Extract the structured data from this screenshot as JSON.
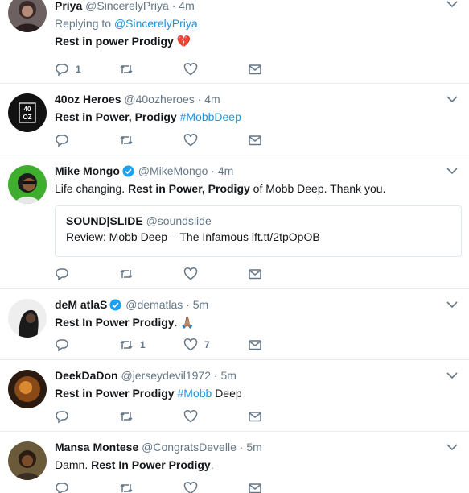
{
  "tweets": [
    {
      "name": "Priya",
      "handle": "@SincerelyPriya",
      "time": "4m",
      "verified": false,
      "reply_prefix": "Replying to",
      "reply_handle": "@SincerelyPriya",
      "text_bold": "Rest in power Prodigy",
      "emoji": "💔",
      "counts": {
        "reply": "1",
        "retweet": "",
        "like": ""
      }
    },
    {
      "name": "40oz Heroes",
      "handle": "@40ozheroes",
      "time": "4m",
      "verified": false,
      "text_bold": "Rest in Power, Prodigy",
      "hashtag": "#MobbDeep",
      "counts": {
        "reply": "",
        "retweet": "",
        "like": ""
      }
    },
    {
      "name": "Mike Mongo",
      "handle": "@MikeMongo",
      "time": "4m",
      "verified": true,
      "text_pre": "Life changing.",
      "text_bold": "Rest in Power, Prodigy",
      "text_post": "of Mobb Deep. Thank you.",
      "quote": {
        "name": "SOUND|SLIDE",
        "handle": "@soundslide",
        "text": "Review: Mobb Deep – The Infamous ift.tt/2tpOpOB"
      },
      "counts": {
        "reply": "",
        "retweet": "",
        "like": ""
      }
    },
    {
      "name": "deM atlaS",
      "handle": "@dematlas",
      "time": "5m",
      "verified": true,
      "text_bold": "Rest In Power Prodigy",
      "text_post": ".",
      "emoji": "🙏🏽",
      "counts": {
        "reply": "",
        "retweet": "1",
        "like": "7"
      }
    },
    {
      "name": "DeekDaDon",
      "handle": "@jerseydevil1972",
      "time": "5m",
      "verified": false,
      "text_bold": "Rest in Power Prodigy",
      "hashtag": "#Mobb",
      "text_post": "Deep",
      "counts": {
        "reply": "",
        "retweet": "",
        "like": ""
      }
    },
    {
      "name": "Mansa Montese",
      "handle": "@CongratsDevelle",
      "time": "5m",
      "verified": false,
      "text_pre": "Damn.",
      "text_bold": "Rest In Power Prodigy",
      "text_post": ".",
      "counts": {
        "reply": "",
        "retweet": "",
        "like": ""
      }
    }
  ],
  "colors": {
    "accent": "#1b95e0",
    "muted": "#657786",
    "text": "#14171a",
    "border": "#e6ecf0"
  },
  "icons": {
    "reply": "reply-icon",
    "retweet": "retweet-icon",
    "like": "heart-icon",
    "dm": "envelope-icon",
    "menu": "chevron-down-icon",
    "verified": "verified-badge-icon"
  },
  "separator": "·"
}
